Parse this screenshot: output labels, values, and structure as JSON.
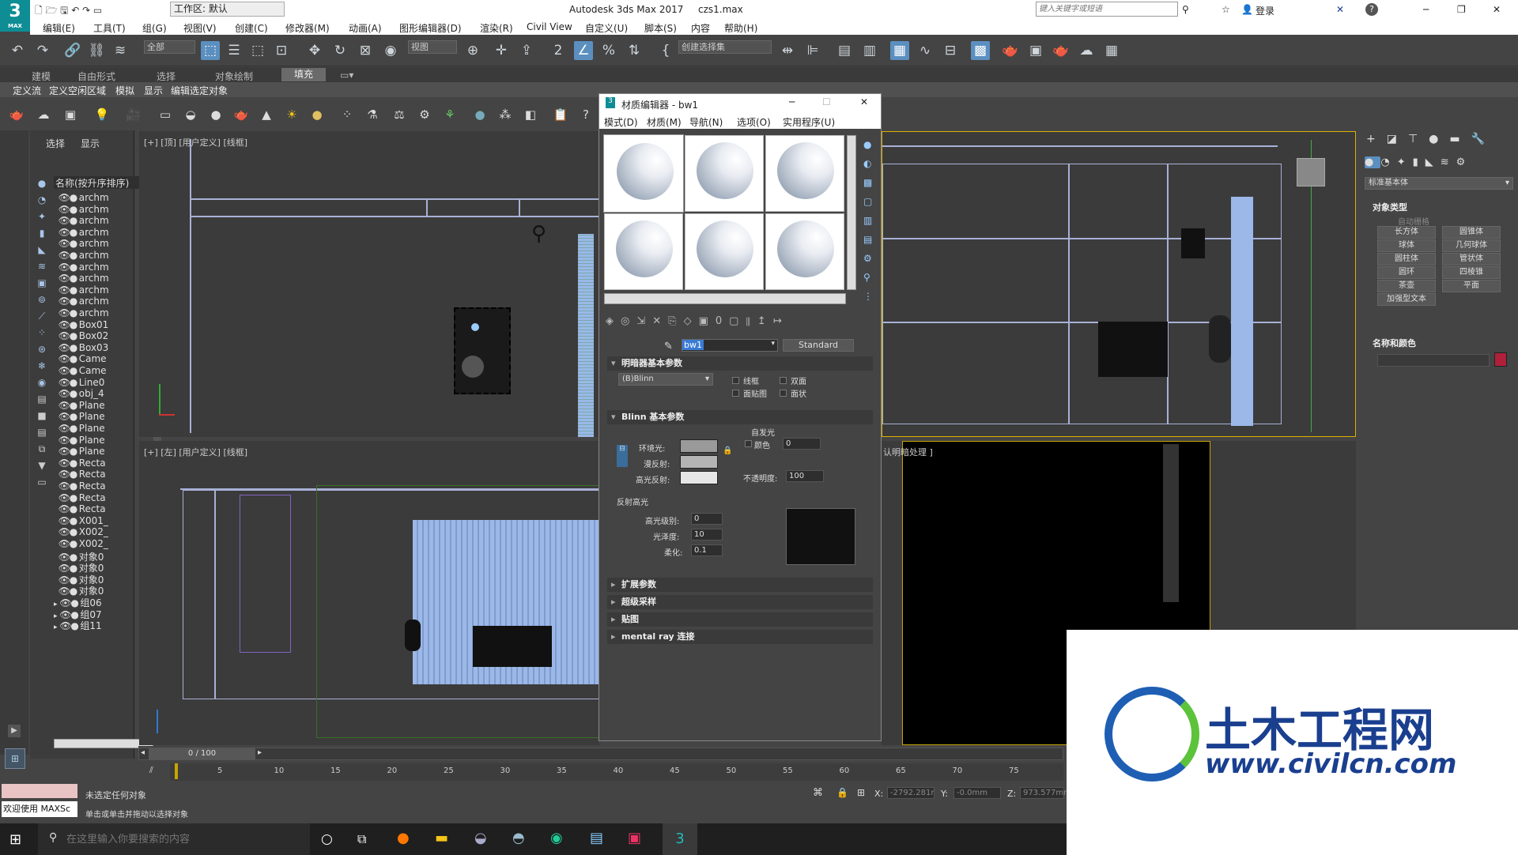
{
  "title_bar": {
    "workspace": "工作区: 默认",
    "app_title": "Autodesk 3ds Max 2017",
    "file_name": "czs1.max",
    "search_placeholder": "键入关键字或短语",
    "login": "登录",
    "help": "?"
  },
  "logo": {
    "big": "3",
    "small": "MAX"
  },
  "menu": [
    "编辑(E)",
    "工具(T)",
    "组(G)",
    "视图(V)",
    "创建(C)",
    "修改器(M)",
    "动画(A)",
    "图形编辑器(D)",
    "渲染(R)",
    "Civil View",
    "自定义(U)",
    "脚本(S)",
    "内容",
    "帮助(H)"
  ],
  "toolbar": {
    "selection_filter": "全部",
    "ref_coord": "视图",
    "named_selection": "创建选择集"
  },
  "ribbon_tabs": [
    "建模",
    "自由形式",
    "选择",
    "对象绘制",
    "填充"
  ],
  "ribbon_subtabs": [
    "定义流",
    "定义空闲区域",
    "模拟",
    "显示",
    "编辑选定对象"
  ],
  "scene_explorer": {
    "tabs": [
      "选择",
      "显示"
    ],
    "header": "名称(按升序排序)",
    "rows": [
      "archm",
      "archm",
      "archm",
      "archm",
      "archm",
      "archm",
      "archm",
      "archm",
      "archm",
      "archm",
      "archm",
      "Box01",
      "Box02",
      "Box03",
      "Came",
      "Came",
      "Line0",
      "obj_4",
      "Plane",
      "Plane",
      "Plane",
      "Plane",
      "Plane",
      "Recta",
      "Recta",
      "Recta",
      "Recta",
      "Recta",
      "X001_",
      "X002_",
      "X002_",
      "对象0",
      "对象0",
      "对象0",
      "对象0",
      "组06",
      "组07",
      "组11"
    ]
  },
  "viewports": {
    "top_left": "[+] [顶] [用户定义] [线框]",
    "bottom_left": "[+] [左] [用户定义] [线框]",
    "bottom_right": "认明暗处理 ]"
  },
  "material_editor": {
    "title": "材质编辑器 - bw1",
    "menu": [
      "模式(D)",
      "材质(M)",
      "导航(N)",
      "选项(O)",
      "实用程序(U)"
    ],
    "material_name": "bw1",
    "material_type": "Standard",
    "shader_rollout": "明暗器基本参数",
    "shader": "(B)Blinn",
    "checks": [
      "线框",
      "双面",
      "面贴图",
      "面状"
    ],
    "blinn_rollout": "Blinn 基本参数",
    "self_illum": "自发光",
    "color_label": "颜色",
    "self_illum_value": "0",
    "ambient": "环境光:",
    "diffuse": "漫反射:",
    "specular": "高光反射:",
    "opacity_label": "不透明度:",
    "opacity_value": "100",
    "spec_highlights": "反射高光",
    "spec_level_label": "高光级别:",
    "spec_level": "0",
    "glossiness_label": "光泽度:",
    "glossiness": "10",
    "soften_label": "柔化:",
    "soften": "0.1",
    "rollouts": [
      "扩展参数",
      "超级采样",
      "贴图",
      "mental ray 连接"
    ]
  },
  "command_panel": {
    "category": "标准基本体",
    "object_type": "对象类型",
    "autogrid": "自动栅格",
    "buttons": [
      "长方体",
      "圆锥体",
      "球体",
      "几何球体",
      "圆柱体",
      "管状体",
      "圆环",
      "四棱锥",
      "茶壶",
      "平面",
      "加强型文本"
    ],
    "name_color": "名称和颜色",
    "color": "#b0203a"
  },
  "timeline": {
    "frame": "0 / 100",
    "ticks": [
      "5",
      "10",
      "15",
      "20",
      "25",
      "30",
      "35",
      "40",
      "45",
      "50",
      "55",
      "60",
      "65",
      "70",
      "75"
    ]
  },
  "status": {
    "welcome": "欢迎使用 MAXSc",
    "line1": "未选定任何对象",
    "line2": "单击或单击并拖动以选择对象",
    "x_label": "X:",
    "x": "-2792.281r",
    "y_label": "Y:",
    "y": "-0.0mm",
    "z_label": "Z:",
    "z": "973.577mm"
  },
  "taskbar": {
    "search_placeholder": "在这里输入你要搜索的内容"
  },
  "watermark": {
    "title": "土木工程网",
    "url": "www.civilcn.com"
  }
}
